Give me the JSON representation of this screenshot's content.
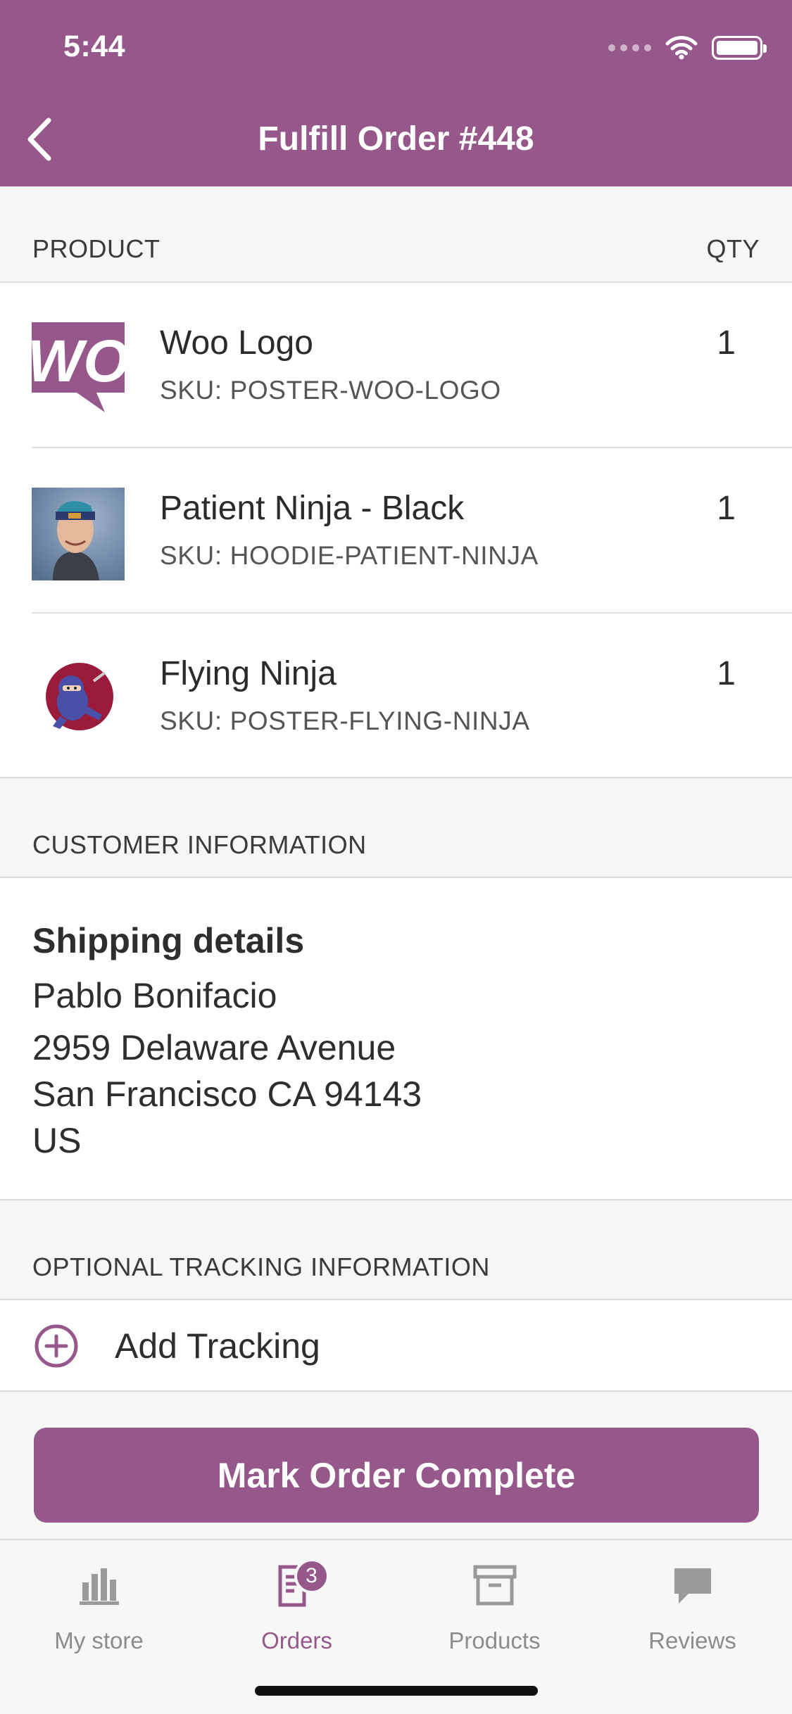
{
  "status_bar": {
    "time": "5:44"
  },
  "header": {
    "title": "Fulfill Order #448"
  },
  "products_section": {
    "header_label": "PRODUCT",
    "qty_label": "QTY",
    "items": [
      {
        "name": "Woo Logo",
        "sku": "SKU: POSTER-WOO-LOGO",
        "qty": "1",
        "thumb": "woo-logo-thumbnail"
      },
      {
        "name": "Patient Ninja - Black",
        "sku": "SKU: HOODIE-PATIENT-NINJA",
        "qty": "1",
        "thumb": "patient-ninja-thumbnail"
      },
      {
        "name": "Flying Ninja",
        "sku": "SKU: POSTER-FLYING-NINJA",
        "qty": "1",
        "thumb": "flying-ninja-thumbnail"
      }
    ]
  },
  "customer_section": {
    "header_label": "CUSTOMER INFORMATION",
    "shipping_title": "Shipping details",
    "name": "Pablo Bonifacio",
    "address_line1": "2959 Delaware Avenue",
    "address_line2": "San Francisco CA 94143",
    "country": "US"
  },
  "tracking_section": {
    "header_label": "OPTIONAL TRACKING INFORMATION",
    "add_label": "Add Tracking",
    "icon": "plus-circle-icon"
  },
  "actions": {
    "complete_label": "Mark Order Complete"
  },
  "tabbar": {
    "tabs": [
      {
        "label": "My store",
        "icon": "bar-chart-icon",
        "active": false
      },
      {
        "label": "Orders",
        "icon": "orders-icon",
        "active": true,
        "badge": "3"
      },
      {
        "label": "Products",
        "icon": "archive-box-icon",
        "active": false
      },
      {
        "label": "Reviews",
        "icon": "speech-bubble-icon",
        "active": false
      }
    ]
  },
  "colors": {
    "brand": "#96588a",
    "background": "#f6f6f6",
    "inactive_tab": "#8c8c8c"
  }
}
